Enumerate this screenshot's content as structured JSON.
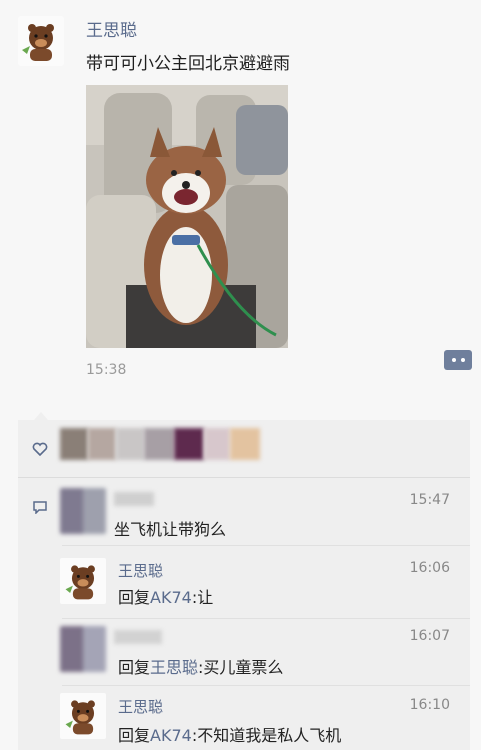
{
  "post": {
    "author": "王思聪",
    "text": "带可可小公主回北京避避雨",
    "time": "15:38"
  },
  "comments": [
    {
      "name_blurred": true,
      "time": "15:47",
      "text": "坐飞机让带狗么"
    },
    {
      "name": "王思聪",
      "time": "16:06",
      "prefix": "回复",
      "mention": "AK74",
      "text": ":让"
    },
    {
      "name_blurred": true,
      "time": "16:07",
      "prefix": "回复",
      "mention": "王思聪",
      "text": ":买儿童票么"
    },
    {
      "name": "王思聪",
      "time": "16:10",
      "prefix": "回复",
      "mention": "AK74",
      "text": ":不知道我是私人飞机"
    }
  ]
}
